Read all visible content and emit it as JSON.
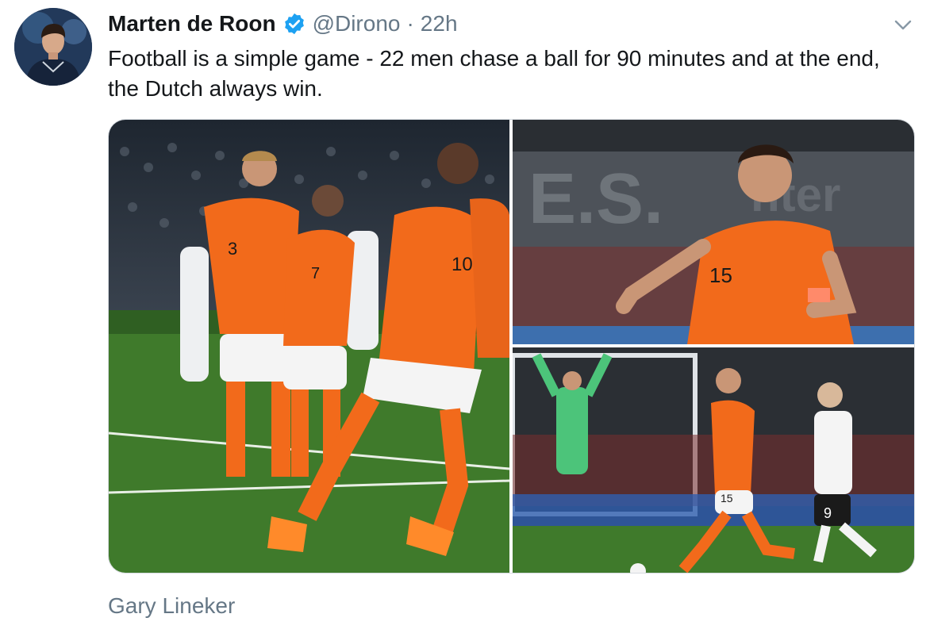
{
  "tweet": {
    "author": {
      "display_name": "Marten de Roon",
      "handle": "@Dirono",
      "verified": true,
      "avatar_icon": "profile-photo"
    },
    "separator": "·",
    "timestamp": "22h",
    "menu_icon": "chevron-down-icon",
    "text": "Football is a simple game - 22 men chase a ball for 90 minutes and at the end, the Dutch always win.",
    "media": [
      {
        "name": "photo-celebration-group",
        "jersey_numbers": [
          "3",
          "7",
          "10"
        ]
      },
      {
        "name": "photo-player-closeup",
        "jersey_numbers": [
          "15"
        ]
      },
      {
        "name": "photo-player-running",
        "jersey_numbers": [
          "15",
          "9"
        ]
      }
    ],
    "credit": "Gary Lineker"
  },
  "colors": {
    "text_primary": "#14171a",
    "text_secondary": "#657786",
    "verified_blue": "#1da1f2",
    "dutch_orange": "#f26a1b",
    "pitch_green": "#3f7a2b"
  }
}
